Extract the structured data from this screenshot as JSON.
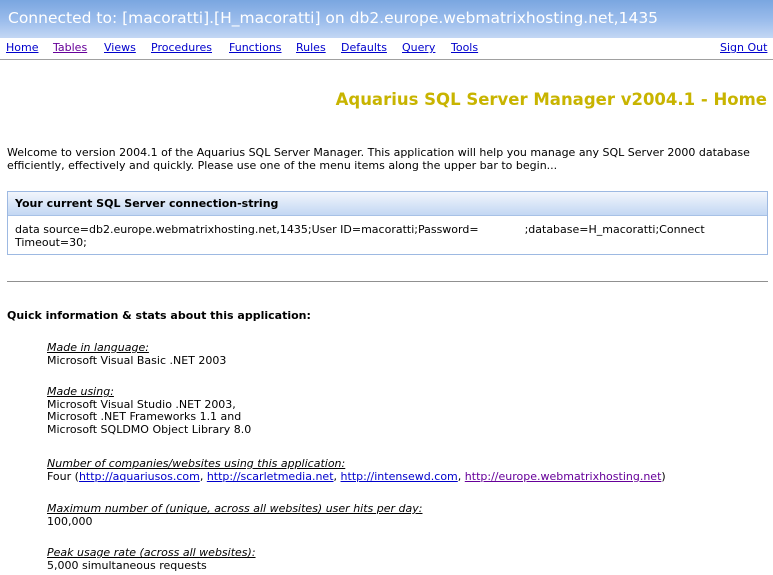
{
  "window": {
    "title": "Connected to: [macoratti].[H_macoratti] on db2.europe.webmatrixhosting.net,1435"
  },
  "menu": {
    "items": [
      "Home",
      "Tables",
      "Views",
      "Procedures",
      "Functions",
      "Rules",
      "Defaults",
      "Query",
      "Tools"
    ],
    "sign_out": "Sign Out"
  },
  "page": {
    "title": "Aquarius SQL Server Manager v2004.1 - Home",
    "welcome": "Welcome to version 2004.1 of the Aquarius SQL Server Manager. This application will help you manage any SQL Server 2000 database efficiently, effectively and quickly. Please use one of the menu items along the upper bar to begin..."
  },
  "connection": {
    "header": "Your current SQL Server connection-string",
    "prefix": "data source=db2.europe.webmatrixhosting.net,1435;User ID=macoratti;Password=",
    "suffix": ";database=H_macoratti;Connect Timeout=30;"
  },
  "stats": {
    "heading": "Quick information & stats about this application:",
    "language": {
      "label": "Made in language:",
      "value": "Microsoft Visual Basic .NET 2003"
    },
    "tools": {
      "label": "Made using:",
      "value": "Microsoft Visual Studio .NET 2003,\nMicrosoft .NET Frameworks 1.1 and\nMicrosoft SQLDMO Object Library 8.0"
    },
    "companies": {
      "label": "Number of companies/websites using this application:",
      "prefix": "Four (",
      "links": [
        "http://aquariusos.com",
        "http://scarletmedia.net",
        "http://intensewd.com",
        "http://europe.webmatrixhosting.net"
      ],
      "sep": ", ",
      "suffix": ")"
    },
    "max_hits": {
      "label": "Maximum number of (unique, across all websites) user hits per day:",
      "value": "100,000"
    },
    "peak": {
      "label": "Peak usage rate (across all websites):",
      "value": "5,000 simultaneous requests"
    }
  }
}
